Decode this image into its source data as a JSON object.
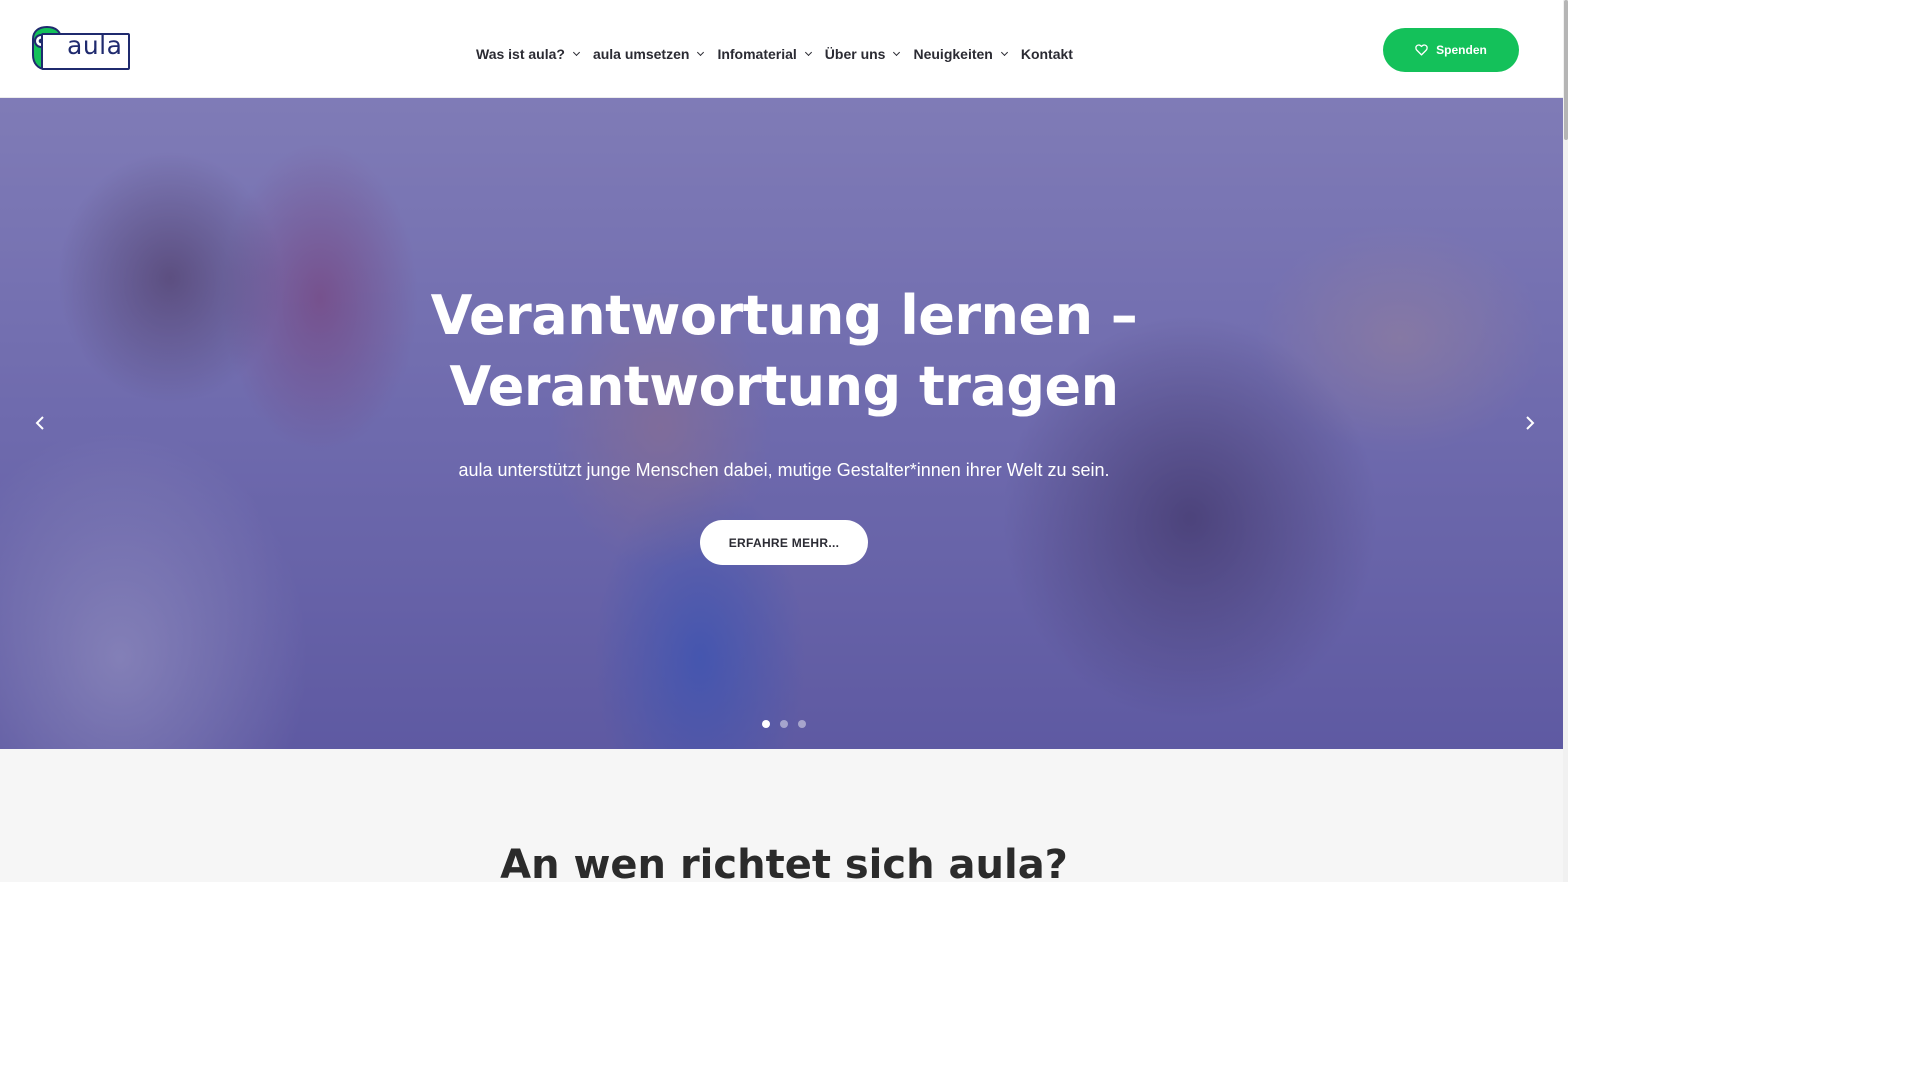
{
  "header": {
    "logo_text": "aula",
    "nav": [
      {
        "label": "Was ist aula?",
        "has_dropdown": true
      },
      {
        "label": "aula umsetzen",
        "has_dropdown": true
      },
      {
        "label": "Infomaterial",
        "has_dropdown": true
      },
      {
        "label": "Über uns",
        "has_dropdown": true
      },
      {
        "label": "Neuigkeiten",
        "has_dropdown": true
      },
      {
        "label": "Kontakt",
        "has_dropdown": false
      }
    ],
    "donate_label": "Spenden"
  },
  "hero": {
    "title_line1": "Verantwortung lernen –",
    "title_line2": "Verantwortung tragen",
    "subtitle": "aula unterstützt junge Menschen dabei, mutige Gestalter*innen ihrer Welt zu sein.",
    "button_label": "ERFAHRE MEHR...",
    "slides_total": 3,
    "active_slide": 1
  },
  "section": {
    "title": "An wen richtet sich aula?"
  },
  "colors": {
    "brand_green": "#14c15a",
    "brand_navy": "#1f2a6e",
    "hero_overlay": "#3a348c"
  }
}
